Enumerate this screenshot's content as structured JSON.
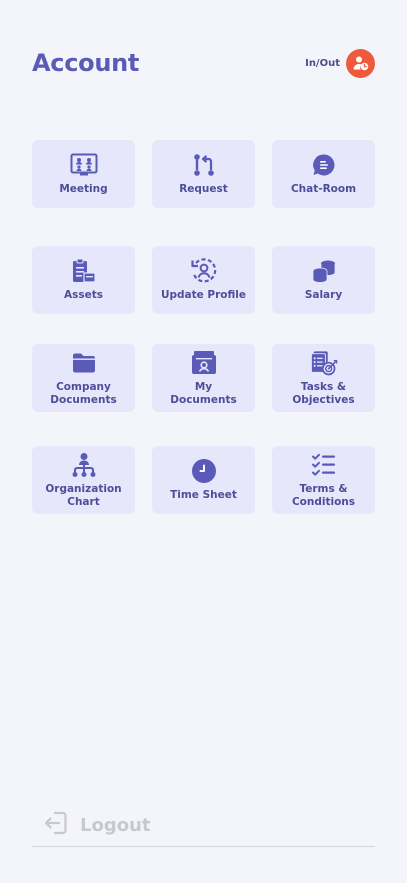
{
  "header": {
    "title": "Account",
    "inout_label": "In/Out",
    "inout_icon": "user-clock-icon"
  },
  "tiles": [
    {
      "label": "Meeting",
      "icon": "meeting-icon"
    },
    {
      "label": "Request",
      "icon": "request-icon"
    },
    {
      "label": "Chat-Room",
      "icon": "chat-icon"
    },
    {
      "label": "Assets",
      "icon": "assets-icon"
    },
    {
      "label": "Update Profile",
      "icon": "update-profile-icon"
    },
    {
      "label": "Salary",
      "icon": "coins-icon"
    },
    {
      "label": "Company\nDocuments",
      "icon": "folder-icon"
    },
    {
      "label": "My\nDocuments",
      "icon": "my-documents-icon"
    },
    {
      "label": "Tasks &\nObjectives",
      "icon": "tasks-icon"
    },
    {
      "label": "Organization\nChart",
      "icon": "org-chart-icon"
    },
    {
      "label": "Time Sheet",
      "icon": "clock-icon"
    },
    {
      "label": "Terms &\nConditions",
      "icon": "checklist-icon"
    }
  ],
  "footer": {
    "logout_label": "Logout",
    "logout_icon": "logout-icon"
  },
  "colors": {
    "background": "#f4f5fa",
    "tile": "#e7e7fb",
    "accent": "#5a5ab8",
    "inout_button": "#ef5a3d",
    "logout_text": "#c8c8cf"
  }
}
